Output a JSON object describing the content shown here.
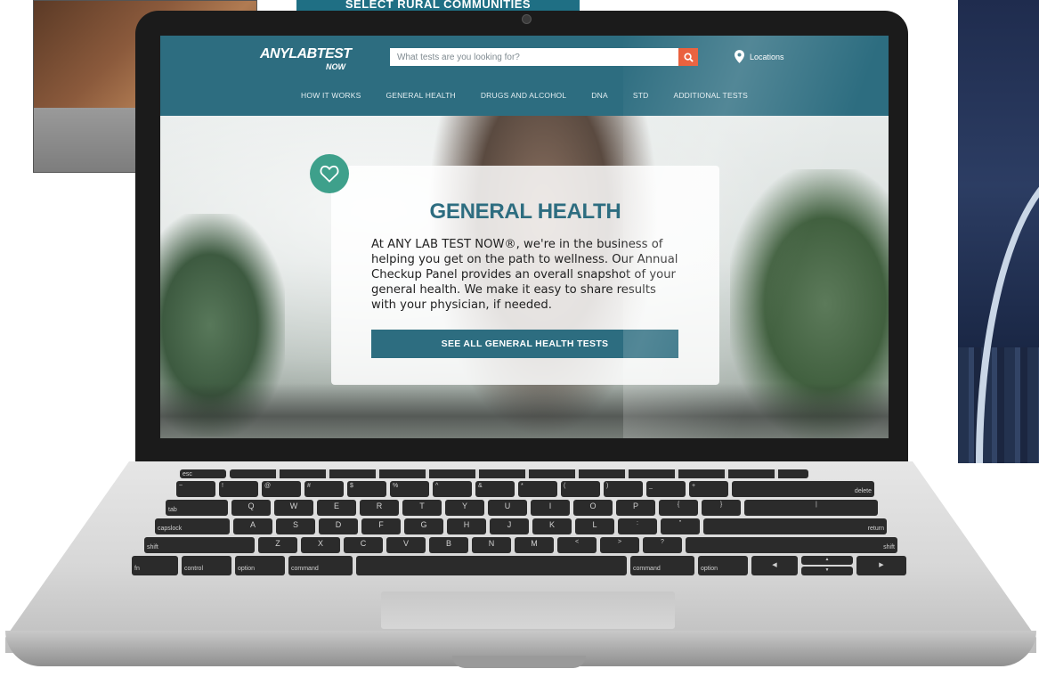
{
  "background": {
    "banner_text": "SELECT RURAL COMMUNITIES"
  },
  "site": {
    "logo_main": "ANYLABTEST",
    "logo_sub": "NOW",
    "search": {
      "placeholder": "What tests are you looking for?",
      "value": ""
    },
    "locations_label": "Locations",
    "nav": [
      "HOW IT WORKS",
      "GENERAL HEALTH",
      "DRUGS AND ALCOHOL",
      "DNA",
      "STD",
      "ADDITIONAL TESTS"
    ],
    "hero": {
      "title": "GENERAL HEALTH",
      "body": "At ANY LAB TEST NOW®, we're in the business of helping you get on the path to wellness. Our Annual Checkup Panel provides an overall snapshot of your general health. We make it easy to share results with your physician, if needed.",
      "button_label": "SEE ALL GENERAL HEALTH TESTS"
    }
  },
  "keyboard": {
    "row1": [
      "~",
      "!",
      "@",
      "#",
      "$",
      "%",
      "^",
      "&",
      "*",
      "(",
      ")",
      "_",
      "+",
      "delete"
    ],
    "row2": [
      "tab",
      "Q",
      "W",
      "E",
      "R",
      "T",
      "Y",
      "U",
      "I",
      "O",
      "P",
      "{",
      "}",
      "|"
    ],
    "row3": [
      "capslock",
      "A",
      "S",
      "D",
      "F",
      "G",
      "H",
      "J",
      "K",
      "L",
      ":",
      "\"",
      "return"
    ],
    "row4": [
      "shift",
      "Z",
      "X",
      "C",
      "V",
      "B",
      "N",
      "M",
      "<",
      ">",
      "?",
      "shift"
    ],
    "row5": [
      "fn",
      "control",
      "option",
      "command",
      "",
      "command",
      "option",
      "◀",
      "▲",
      "▶"
    ]
  },
  "colors": {
    "header": "#2d6d80",
    "accent": "#e8512a",
    "badge": "#3ea08b"
  }
}
